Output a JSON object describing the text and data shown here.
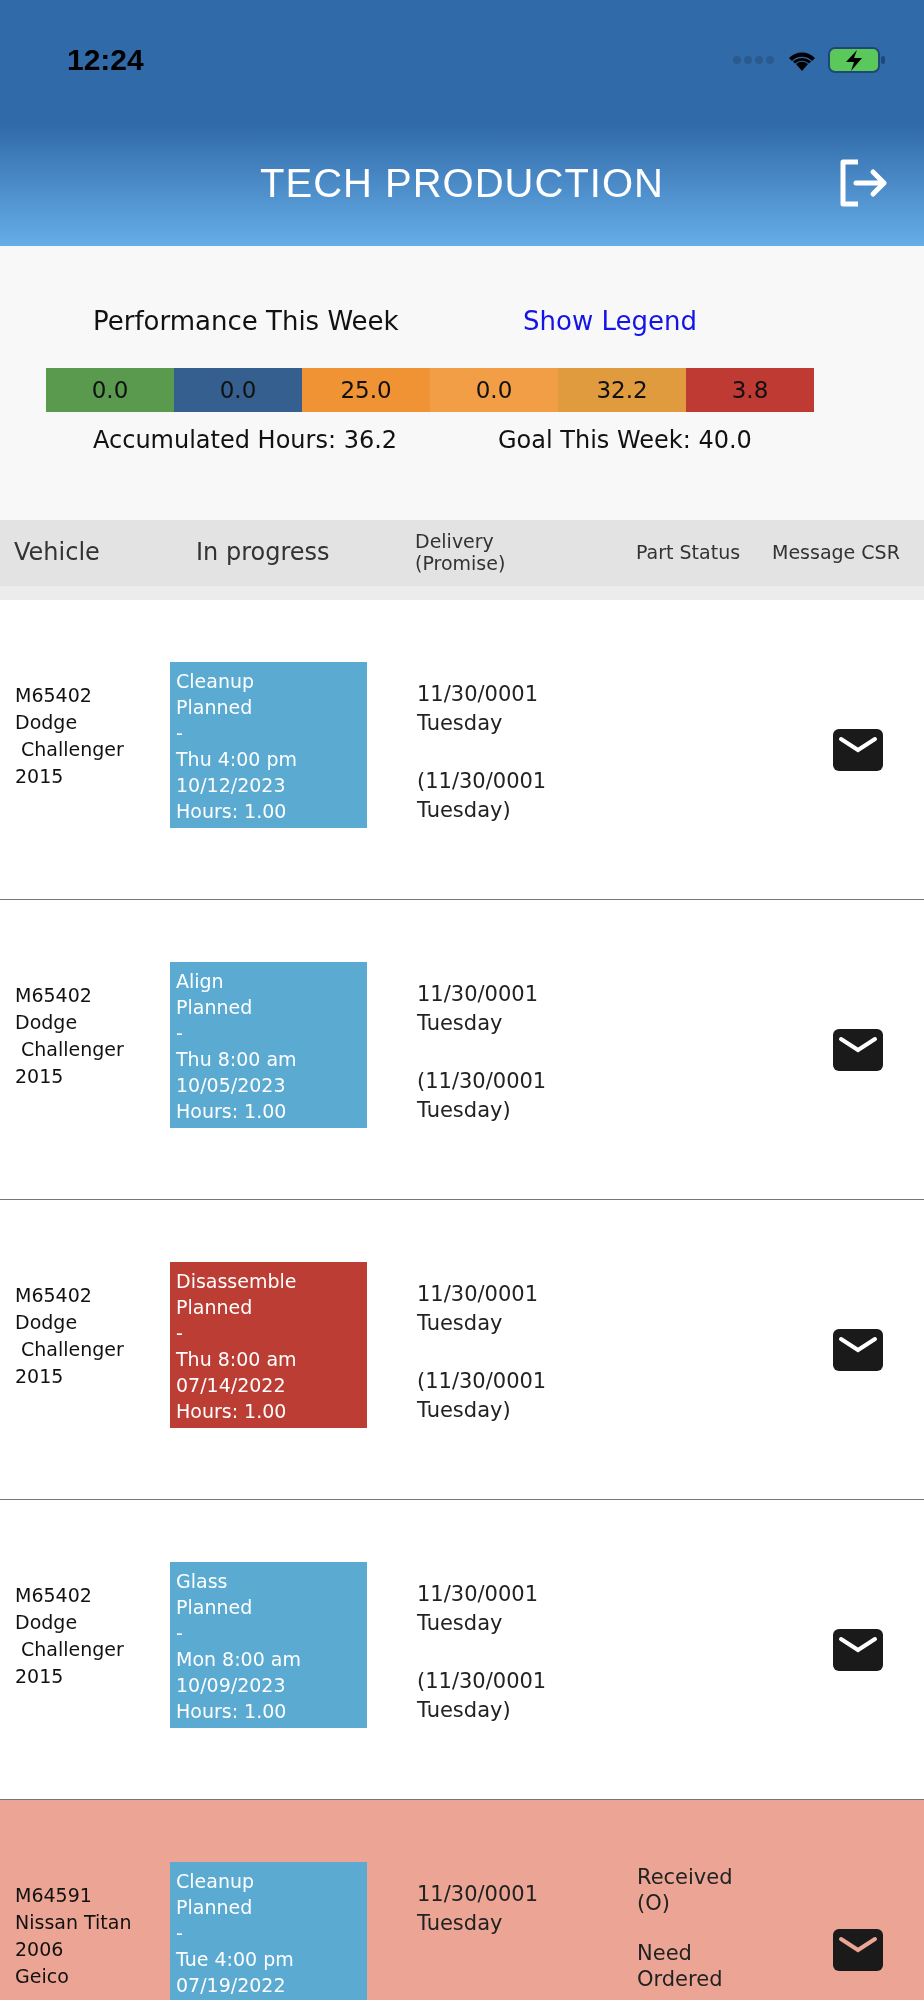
{
  "status_bar": {
    "time": "12:24"
  },
  "header": {
    "title": "TECH PRODUCTION"
  },
  "performance": {
    "title": "Performance This Week",
    "legend_link": "Show Legend",
    "segments": [
      {
        "value": "0.0",
        "color": "#5a9a4e"
      },
      {
        "value": "0.0",
        "color": "#355f8e"
      },
      {
        "value": "25.0",
        "color": "#ef9334"
      },
      {
        "value": "0.0",
        "color": "#f29e46"
      },
      {
        "value": "32.2",
        "color": "#e09b3e"
      },
      {
        "value": "3.8",
        "color": "#bf3a32"
      }
    ],
    "accumulated": "Accumulated Hours: 36.2",
    "goal": "Goal This Week: 40.0"
  },
  "table": {
    "columns": [
      "Vehicle",
      "In progress",
      "Delivery\n(Promise)",
      "Part Status",
      "Message CSR"
    ],
    "rows": [
      {
        "vehicle": [
          "M65402",
          "Dodge",
          " Challenger",
          "2015"
        ],
        "task": {
          "lines": [
            "Cleanup",
            "Planned",
            "-",
            "Thu 4:00 pm",
            "10/12/2023",
            "Hours: 1.00"
          ],
          "color": "#5aaad2"
        },
        "delivery": "11/30/0001\nTuesday",
        "promise": "(11/30/0001\nTuesday)",
        "part_status": [],
        "highlighted": false
      },
      {
        "vehicle": [
          "M65402",
          "Dodge",
          " Challenger",
          "2015"
        ],
        "task": {
          "lines": [
            "Align",
            "Planned",
            "-",
            "Thu 8:00 am",
            "10/05/2023",
            "Hours: 1.00"
          ],
          "color": "#5aaad2"
        },
        "delivery": "11/30/0001\nTuesday",
        "promise": "(11/30/0001\nTuesday)",
        "part_status": [],
        "highlighted": false
      },
      {
        "vehicle": [
          "M65402",
          "Dodge",
          " Challenger",
          "2015"
        ],
        "task": {
          "lines": [
            "Disassemble",
            "Planned",
            "-",
            "Thu 8:00 am",
            "07/14/2022",
            "Hours: 1.00"
          ],
          "color": "#bb3d34"
        },
        "delivery": "11/30/0001\nTuesday",
        "promise": "(11/30/0001\nTuesday)",
        "part_status": [],
        "highlighted": false
      },
      {
        "vehicle": [
          "M65402",
          "Dodge",
          " Challenger",
          "2015"
        ],
        "task": {
          "lines": [
            "Glass",
            "Planned",
            "-",
            "Mon 8:00 am",
            "10/09/2023",
            "Hours: 1.00"
          ],
          "color": "#5aaad2"
        },
        "delivery": "11/30/0001\nTuesday",
        "promise": "(11/30/0001\nTuesday)",
        "part_status": [],
        "highlighted": false
      },
      {
        "vehicle": [
          "M64591",
          "Nissan Titan",
          "2006",
          "Geico"
        ],
        "task": {
          "lines": [
            "Cleanup",
            "Planned",
            "-",
            "Tue 4:00 pm",
            "07/19/2022"
          ],
          "color": "#5aaad2"
        },
        "delivery": "11/30/0001\nTuesday",
        "part_status": [
          "Received\n(O)",
          "Need\nOrdered"
        ],
        "highlighted": true
      }
    ]
  }
}
